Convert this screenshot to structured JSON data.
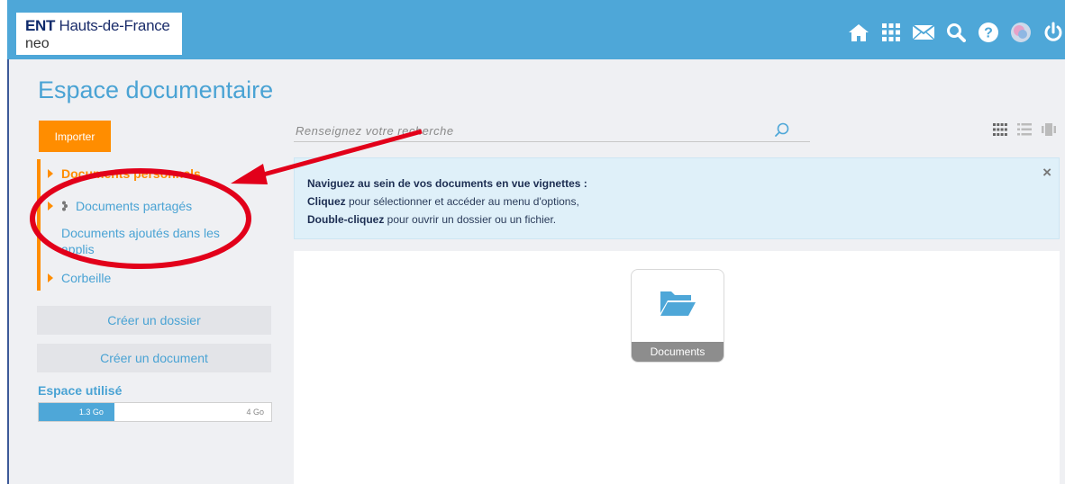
{
  "header": {
    "logo_brand": "ENT",
    "logo_region": " Hauts-de-France",
    "logo_sub": "neo"
  },
  "icons": [
    "home-icon",
    "apps-grid-icon",
    "mail-icon",
    "search-icon",
    "help-icon",
    "avatar",
    "power-icon"
  ],
  "page": {
    "title": "Espace documentaire"
  },
  "sidebar": {
    "import_label": "Importer",
    "items": [
      {
        "label": "Documents personnels",
        "active": true
      },
      {
        "label": "Documents partagés",
        "active": false
      },
      {
        "label": "Documents ajoutés dans les applis",
        "active": false
      },
      {
        "label": "Corbeille",
        "active": false
      }
    ],
    "create_folder": "Créer un dossier",
    "create_document": "Créer un document",
    "space_label": "Espace utilisé",
    "used": "1.3 Go",
    "total": "4 Go",
    "used_fraction": 0.325
  },
  "search": {
    "placeholder": "Renseignez votre recherche"
  },
  "info": {
    "line1": "Naviguez au sein de vos documents en vue vignettes :",
    "line2_bold": "Cliquez",
    "line2_rest": " pour sélectionner et accéder au menu d'options,",
    "line3_bold": "Double-cliquez",
    "line3_rest": " pour ouvrir un dossier ou un fichier.",
    "close": "×"
  },
  "content": {
    "folders": [
      {
        "name": "Documents"
      }
    ]
  },
  "colors": {
    "accent": "#4ea7d8",
    "orange": "#ff8d00",
    "annotation": "#e2001a"
  }
}
